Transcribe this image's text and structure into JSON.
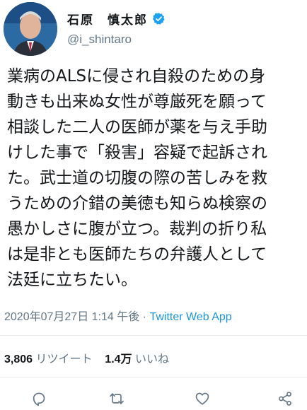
{
  "user": {
    "display_name": "石原　慎太郎",
    "handle": "@i_shintaro",
    "verified": true
  },
  "tweet": {
    "lines": [
      "業病のALSに侵され自殺のための身",
      "動きも出来ぬ女性が尊厳死を願って",
      "相談した二人の医師が薬を与え手助",
      "けした事で「殺害」容疑で起訴され",
      "た。武士道の切腹の際の苦しみを救",
      "うための介錯の美徳も知らぬ検察の",
      "愚かしさに腹が立つ。裁判の折り私",
      "は是非とも医師たちの弁護人として",
      "法廷に立ちたい。"
    ]
  },
  "meta": {
    "timestamp": "2020年07月27日 1:14 午後",
    "separator": " · ",
    "app": "Twitter Web App"
  },
  "stats": {
    "retweets_count": "3,806",
    "retweets_label": "リツイート",
    "likes_count": "1.4万",
    "likes_label": "いいね"
  },
  "actions": [
    {
      "name": "reply",
      "icon": "reply-icon"
    },
    {
      "name": "retweet",
      "icon": "retweet-icon"
    },
    {
      "name": "like",
      "icon": "heart-icon"
    },
    {
      "name": "share",
      "icon": "share-icon"
    }
  ],
  "colors": {
    "text": "#14171a",
    "secondary": "#657786",
    "link": "#1b95e0",
    "verified": "#1da1f2",
    "divider": "#e6ecf0"
  }
}
